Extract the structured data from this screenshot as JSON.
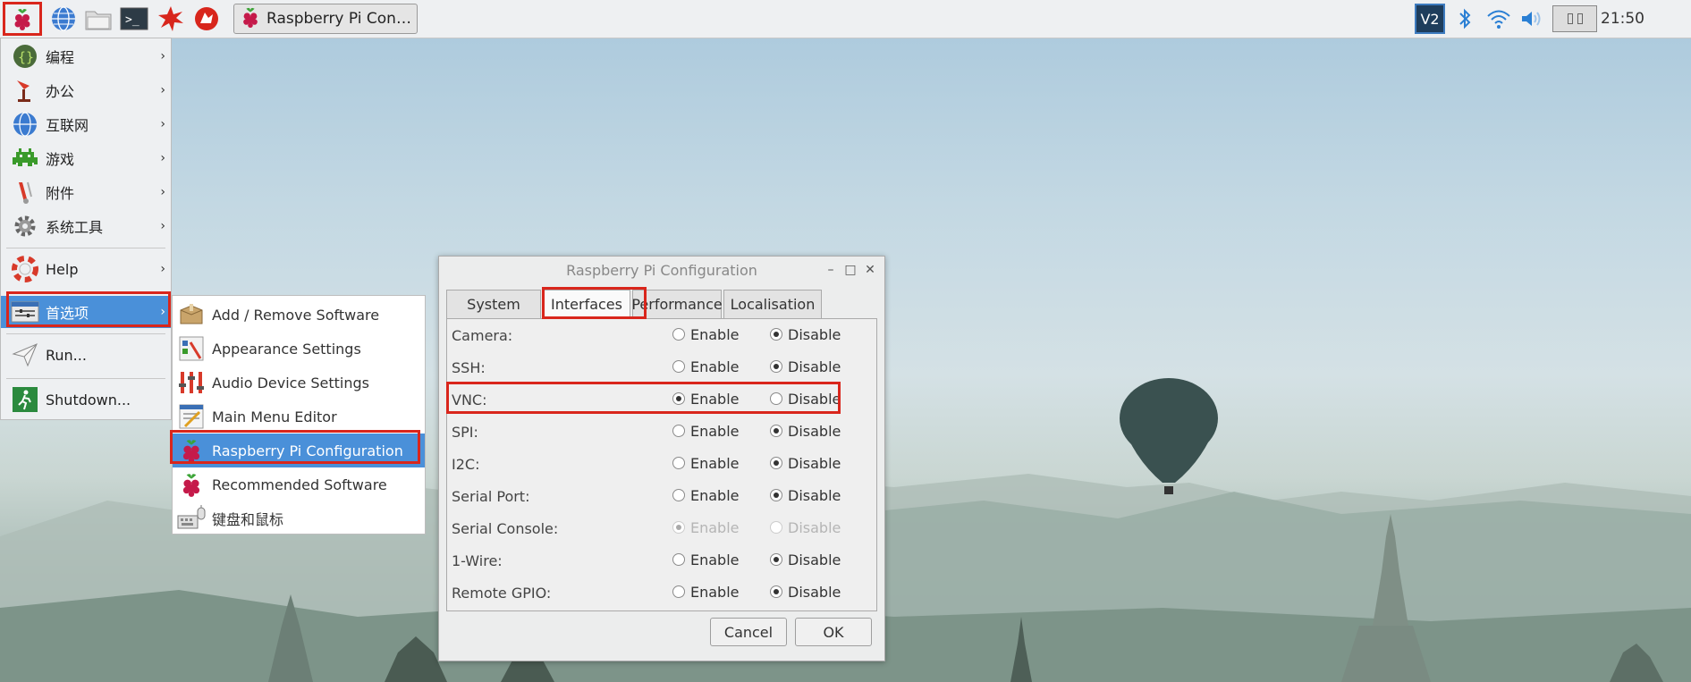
{
  "taskbar": {
    "launchers": [
      "raspberry-menu-icon",
      "browser-icon",
      "file-manager-icon",
      "terminal-icon",
      "mathematica-icon",
      "wolfram-icon"
    ],
    "task_button": "Raspberry Pi Configu...",
    "tray": {
      "vnc": "V2",
      "clock": "21:50"
    }
  },
  "main_menu": {
    "items": [
      {
        "label": "编程",
        "icon": "programming-icon",
        "submenu": true
      },
      {
        "label": "办公",
        "icon": "office-icon",
        "submenu": true
      },
      {
        "label": "互联网",
        "icon": "internet-icon",
        "submenu": true
      },
      {
        "label": "游戏",
        "icon": "games-icon",
        "submenu": true
      },
      {
        "label": "附件",
        "icon": "accessories-icon",
        "submenu": true
      },
      {
        "label": "系统工具",
        "icon": "system-tools-icon",
        "submenu": true
      },
      {
        "label": "Help",
        "icon": "help-icon",
        "submenu": true
      },
      {
        "label": "首选项",
        "icon": "preferences-icon",
        "submenu": true,
        "selected": true
      },
      {
        "label": "Run...",
        "icon": "run-icon",
        "submenu": false
      },
      {
        "label": "Shutdown...",
        "icon": "shutdown-icon",
        "submenu": false
      }
    ],
    "arrow": "›"
  },
  "preferences_menu": {
    "items": [
      {
        "label": "Add / Remove Software",
        "icon": "add-remove-software-icon"
      },
      {
        "label": "Appearance Settings",
        "icon": "appearance-settings-icon"
      },
      {
        "label": "Audio Device Settings",
        "icon": "audio-settings-icon"
      },
      {
        "label": "Main Menu Editor",
        "icon": "menu-editor-icon"
      },
      {
        "label": "Raspberry Pi Configuration",
        "icon": "raspberry-icon",
        "selected": true
      },
      {
        "label": "Recommended Software",
        "icon": "raspberry-icon"
      },
      {
        "label": "键盘和鼠标",
        "icon": "keyboard-mouse-icon"
      }
    ]
  },
  "dialog": {
    "title": "Raspberry Pi Configuration",
    "window_buttons": {
      "minimize": "–",
      "maximize": "□",
      "close": "✕"
    },
    "tabs": [
      {
        "label": "System"
      },
      {
        "label": "Interfaces",
        "active": true
      },
      {
        "label": "Performance"
      },
      {
        "label": "Localisation"
      }
    ],
    "option_labels": {
      "enable": "Enable",
      "disable": "Disable"
    },
    "rows": [
      {
        "name": "Camera:",
        "value": "disable",
        "dim": false
      },
      {
        "name": "SSH:",
        "value": "disable",
        "dim": false
      },
      {
        "name": "VNC:",
        "value": "enable",
        "dim": false
      },
      {
        "name": "SPI:",
        "value": "disable",
        "dim": false
      },
      {
        "name": "I2C:",
        "value": "disable",
        "dim": false
      },
      {
        "name": "Serial Port:",
        "value": "disable",
        "dim": false
      },
      {
        "name": "Serial Console:",
        "value": "enable",
        "dim": true
      },
      {
        "name": "1-Wire:",
        "value": "disable",
        "dim": false
      },
      {
        "name": "Remote GPIO:",
        "value": "disable",
        "dim": false
      }
    ],
    "buttons": {
      "cancel": "Cancel",
      "ok": "OK"
    }
  },
  "colors": {
    "highlight": "#d9261c",
    "selection": "#4a90d9"
  }
}
